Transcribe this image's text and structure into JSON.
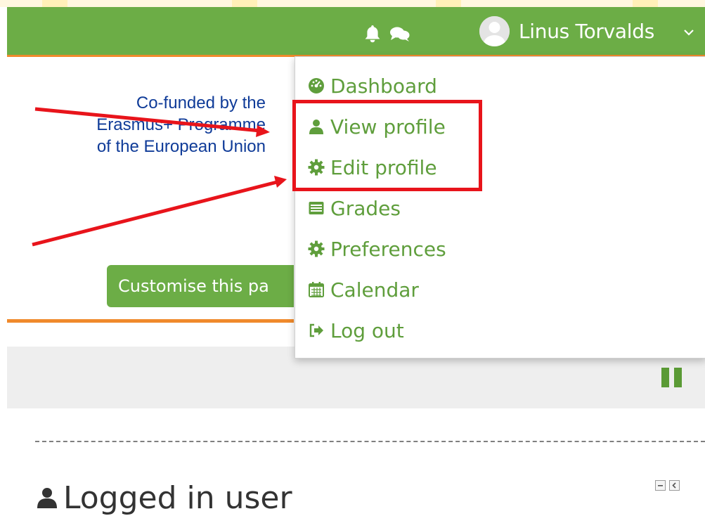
{
  "navbar": {
    "user_name": "Linus Torvalds",
    "icons": [
      "bell-icon",
      "chat-icon",
      "avatar",
      "chevron-down-icon"
    ],
    "colors": {
      "bar": "#6cad46",
      "accent": "#f08a2c"
    }
  },
  "logo": {
    "lines": [
      "Co-funded by the",
      "Erasmus+ Programme",
      "of the European Union"
    ]
  },
  "customise_button": {
    "label": "Customise this pa"
  },
  "user_menu": {
    "items": [
      {
        "label": "Dashboard",
        "icon": "dashboard-icon"
      },
      {
        "label": "View profile",
        "icon": "user-icon"
      },
      {
        "label": "Edit profile",
        "icon": "cog-icon"
      },
      {
        "label": "Grades",
        "icon": "table-icon"
      },
      {
        "label": "Preferences",
        "icon": "cog-icon"
      },
      {
        "label": "Calendar",
        "icon": "calendar-icon"
      },
      {
        "label": "Log out",
        "icon": "sign-out-icon"
      }
    ],
    "highlighted_items": [
      "View profile",
      "Edit profile"
    ],
    "annotation_color": "#e8141b"
  },
  "block": {
    "title": "Logged in user",
    "icon": "user-icon",
    "controls": [
      "minimize-icon",
      "dock-icon"
    ]
  }
}
